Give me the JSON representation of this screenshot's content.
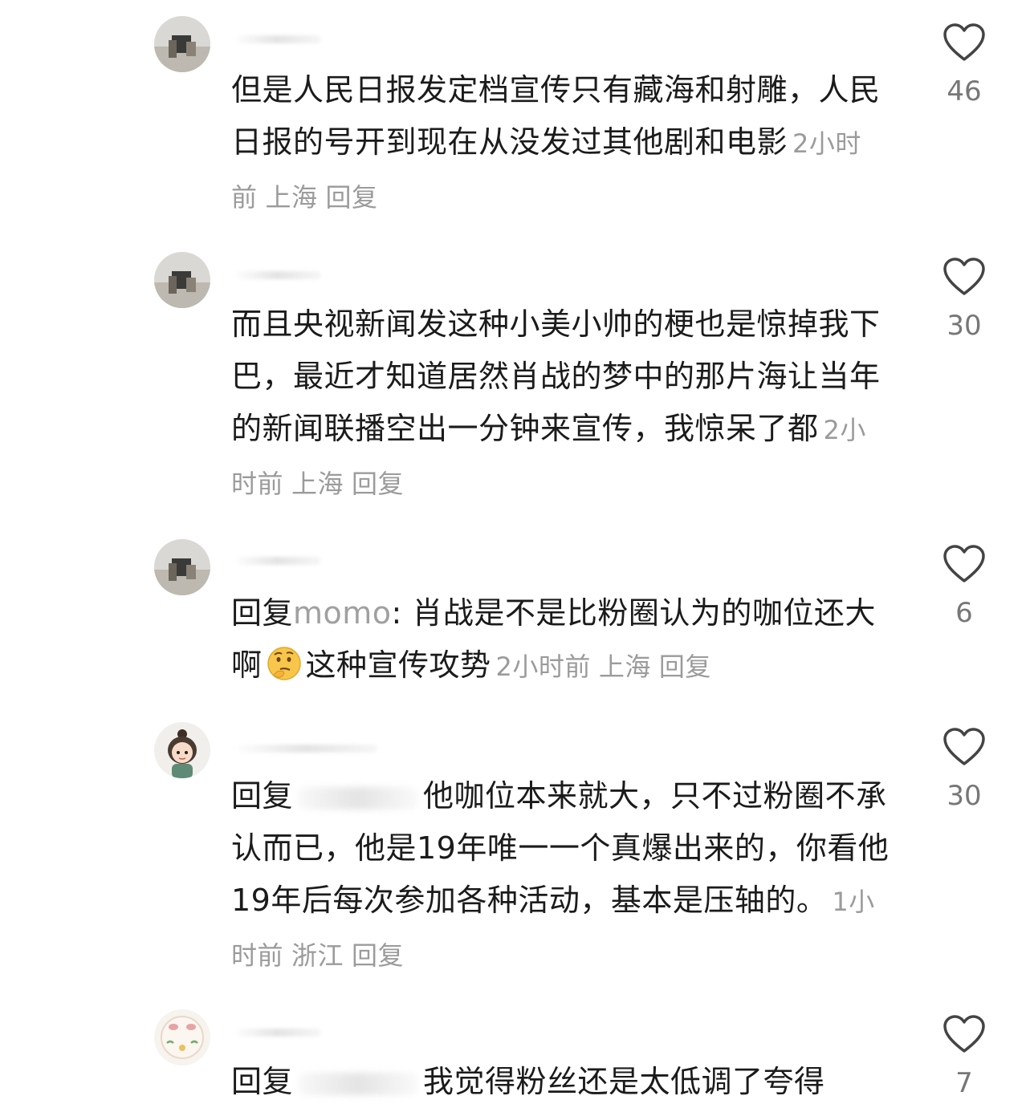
{
  "comments": [
    {
      "text": "但是人民日报发定档宣传只有藏海和射雕，人民日报的号开到现在从没发过其他剧和电影",
      "time": "2小时前",
      "location": "上海",
      "reply_label": "回复",
      "likes": "46"
    },
    {
      "text": "而且央视新闻发这种小美小帅的梗也是惊掉我下巴，最近才知道居然肖战的梦中的那片海让当年的新闻联播空出一分钟来宣传，我惊呆了都",
      "time": "2小时前",
      "location": "上海",
      "reply_label": "回复",
      "likes": "30"
    },
    {
      "prefix": "回复",
      "mention": "momo",
      "text_before_emoji": ": 肖战是不是比粉圈认为的咖位还大啊",
      "emoji": "thinking-face",
      "text_after_emoji": "这种宣传攻势",
      "time": "2小时前",
      "location": "上海",
      "reply_label": "回复",
      "likes": "6"
    },
    {
      "prefix": "回复",
      "text": "他咖位本来就大，只不过粉圈不承认而已，他是19年唯一一个真爆出来的，你看他19年后每次参加各种活动，基本是压轴的。",
      "time": "1小时前",
      "location": "浙江",
      "reply_label": "回复",
      "likes": "30"
    },
    {
      "prefix": "回复",
      "text": "我觉得粉丝还是太低调了夸得",
      "likes": "7"
    }
  ],
  "colors": {
    "text": "#1b1b1b",
    "meta": "#9b9b9b",
    "like_count": "#777777",
    "heart_outline": "#444444"
  },
  "icons": {
    "like": "heart-outline-icon",
    "emoji": "thinking-face-emoji"
  }
}
